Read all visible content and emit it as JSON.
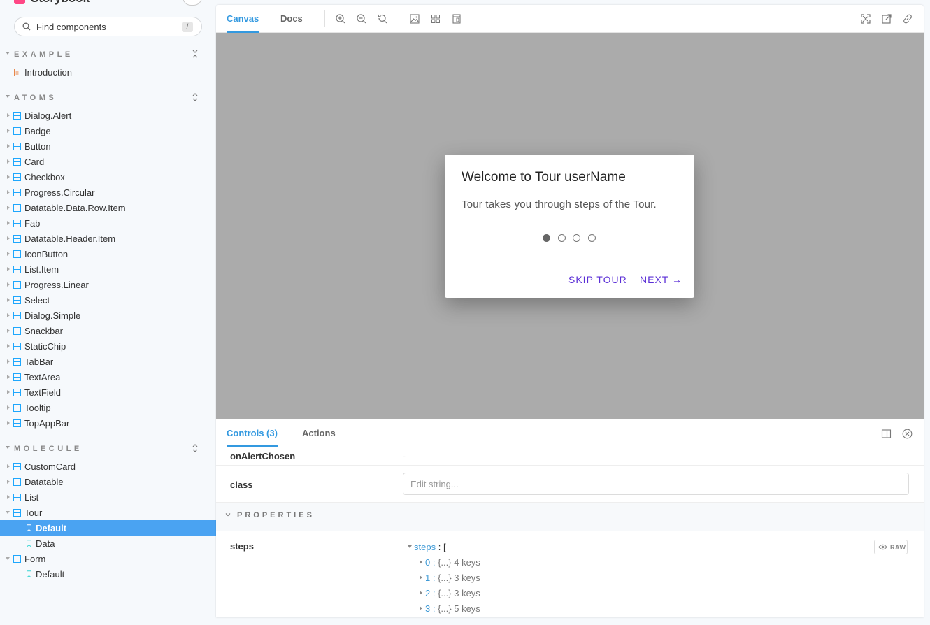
{
  "sidebar": {
    "search": {
      "placeholder": "Find components",
      "shortcut": "/"
    },
    "groups": [
      {
        "label": "EXAMPLE"
      },
      {
        "label": "ATOMS"
      },
      {
        "label": "MOLECULE"
      }
    ],
    "example_items": [
      "Introduction"
    ],
    "atoms_items": [
      "Dialog.Alert",
      "Badge",
      "Button",
      "Card",
      "Checkbox",
      "Progress.Circular",
      "Datatable.Data.Row.Item",
      "Fab",
      "Datatable.Header.Item",
      "IconButton",
      "List.Item",
      "Progress.Linear",
      "Select",
      "Dialog.Simple",
      "Snackbar",
      "StaticChip",
      "TabBar",
      "TextArea",
      "TextField",
      "Tooltip",
      "TopAppBar"
    ],
    "molecule_items": [
      "CustomCard",
      "Datatable",
      "List",
      "Tour"
    ],
    "tour_stories": [
      "Default",
      "Data"
    ],
    "form_item": "Form",
    "form_stories": [
      "Default"
    ],
    "selected_story": "Default"
  },
  "toolbar": {
    "tabs": [
      "Canvas",
      "Docs"
    ],
    "active_tab": "Canvas",
    "icons_left": [
      "zoom-in-icon",
      "zoom-out-icon",
      "zoom-reset-icon",
      "background-icon",
      "grid-icon",
      "outline-icon"
    ],
    "icons_right": [
      "fullscreen-icon",
      "open-new-tab-icon",
      "copy-link-icon"
    ]
  },
  "canvas": {
    "background": "#ababab",
    "dialog": {
      "title": "Welcome to Tour userName",
      "body": "Tour takes you through steps of the Tour.",
      "steps_total": 4,
      "active_step": 1,
      "skip_label": "SKIP TOUR",
      "next_label": "NEXT →",
      "accent": "#5b2fd6"
    }
  },
  "addons": {
    "tabs": [
      "Controls (3)",
      "Actions"
    ],
    "active_tab": "Controls (3)",
    "rows": {
      "on_alert_chosen": {
        "name": "onAlertChosen",
        "value": "-"
      },
      "class": {
        "name": "class",
        "placeholder": "Edit string..."
      }
    },
    "section": "PROPERTIES",
    "steps": {
      "name": "steps",
      "root_key": "steps",
      "root_open": "[",
      "raw_label": "RAW",
      "entries": [
        {
          "index": "0",
          "summary": "{...}",
          "keys": "4 keys"
        },
        {
          "index": "1",
          "summary": "{...}",
          "keys": "3 keys"
        },
        {
          "index": "2",
          "summary": "{...}",
          "keys": "3 keys"
        },
        {
          "index": "3",
          "summary": "{...}",
          "keys": "5 keys"
        }
      ]
    }
  }
}
